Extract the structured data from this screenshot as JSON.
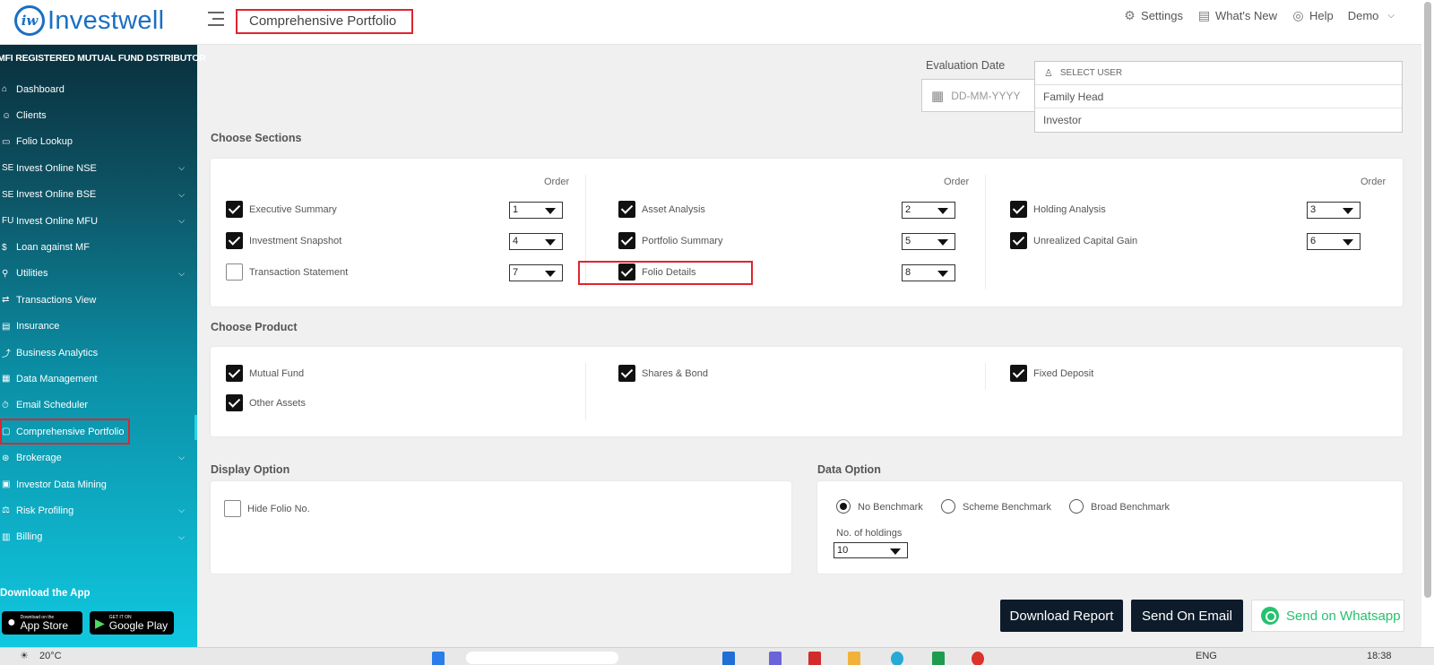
{
  "header": {
    "logo_text": "Investwell",
    "logo_mark": "iw",
    "page_title": "Comprehensive Portfolio",
    "nav": [
      {
        "label": "Settings",
        "icon": "gear-icon"
      },
      {
        "label": "What's New",
        "icon": "news-icon"
      },
      {
        "label": "Help",
        "icon": "help-icon"
      }
    ],
    "user": "Demo"
  },
  "sidebar": {
    "title": "MFI REGISTERED MUTUAL FUND DSTRIBUTOR",
    "items": [
      {
        "label": "Dashboard",
        "icon": "⌂",
        "caret": false
      },
      {
        "label": "Clients",
        "icon": "☺",
        "caret": false
      },
      {
        "label": "Folio Lookup",
        "icon": "▭",
        "caret": false
      },
      {
        "label": "Invest Online NSE",
        "icon": "SE",
        "caret": true
      },
      {
        "label": "Invest Online BSE",
        "icon": "SE",
        "caret": true
      },
      {
        "label": "Invest Online MFU",
        "icon": "FU",
        "caret": true
      },
      {
        "label": "Loan against MF",
        "icon": "$",
        "caret": false
      },
      {
        "label": "Utilities",
        "icon": "⚲",
        "caret": true
      },
      {
        "label": "Transactions View",
        "icon": "⇄",
        "caret": false
      },
      {
        "label": "Insurance",
        "icon": "▤",
        "caret": false
      },
      {
        "label": "Business Analytics",
        "icon": "⤴",
        "caret": false
      },
      {
        "label": "Data Management",
        "icon": "▦",
        "caret": false
      },
      {
        "label": "Email Scheduler",
        "icon": "⏱",
        "caret": false
      },
      {
        "label": "Comprehensive Portfolio",
        "icon": "▢",
        "caret": false
      },
      {
        "label": "Brokerage",
        "icon": "⊛",
        "caret": true
      },
      {
        "label": "Investor Data Mining",
        "icon": "▣",
        "caret": false
      },
      {
        "label": "Risk Profiling",
        "icon": "⚖",
        "caret": true
      },
      {
        "label": "Billing",
        "icon": "▥",
        "caret": true
      }
    ],
    "download_title": "Download the App",
    "app_store": {
      "small": "Download on the",
      "big": "App Store"
    },
    "google_play": {
      "small": "GET IT ON",
      "big": "Google Play"
    }
  },
  "filters": {
    "evaluation_date_label": "Evaluation Date",
    "date_placeholder": "DD-MM-YYYY",
    "select_user_label": "SELECT USER",
    "user_options": [
      "Family Head",
      "Investor"
    ]
  },
  "sections": {
    "label": "Choose Sections",
    "order_label": "Order",
    "items": [
      {
        "label": "Executive Summary",
        "checked": true,
        "order": "1"
      },
      {
        "label": "Asset Analysis",
        "checked": true,
        "order": "2"
      },
      {
        "label": "Holding Analysis",
        "checked": true,
        "order": "3"
      },
      {
        "label": "Investment Snapshot",
        "checked": true,
        "order": "4"
      },
      {
        "label": "Portfolio Summary",
        "checked": true,
        "order": "5"
      },
      {
        "label": "Unrealized Capital Gain",
        "checked": true,
        "order": "6"
      },
      {
        "label": "Transaction Statement",
        "checked": false,
        "order": "7"
      },
      {
        "label": "Folio Details",
        "checked": true,
        "order": "8"
      }
    ]
  },
  "products": {
    "label": "Choose Product",
    "items": [
      {
        "label": "Mutual Fund",
        "checked": true
      },
      {
        "label": "Shares & Bond",
        "checked": true
      },
      {
        "label": "Fixed Deposit",
        "checked": true
      },
      {
        "label": "Other Assets",
        "checked": true
      }
    ]
  },
  "display_option": {
    "label": "Display Option",
    "hide_folio_label": "Hide Folio No.",
    "hide_folio_checked": false
  },
  "data_option": {
    "label": "Data Option",
    "benchmarks": [
      {
        "label": "No Benchmark",
        "selected": true
      },
      {
        "label": "Scheme Benchmark",
        "selected": false
      },
      {
        "label": "Broad Benchmark",
        "selected": false
      }
    ],
    "holdings_label": "No. of holdings",
    "holdings_value": "10"
  },
  "actions": {
    "download": "Download Report",
    "email": "Send On Email",
    "whatsapp": "Send on Whatsapp"
  },
  "taskbar": {
    "temperature": "20°C",
    "language": "ENG",
    "time": "18:38"
  },
  "colors": {
    "brand": "#1a6fc4",
    "highlight": "#e0242f",
    "button_dark": "#0d1b2a",
    "whatsapp": "#25c26e"
  }
}
